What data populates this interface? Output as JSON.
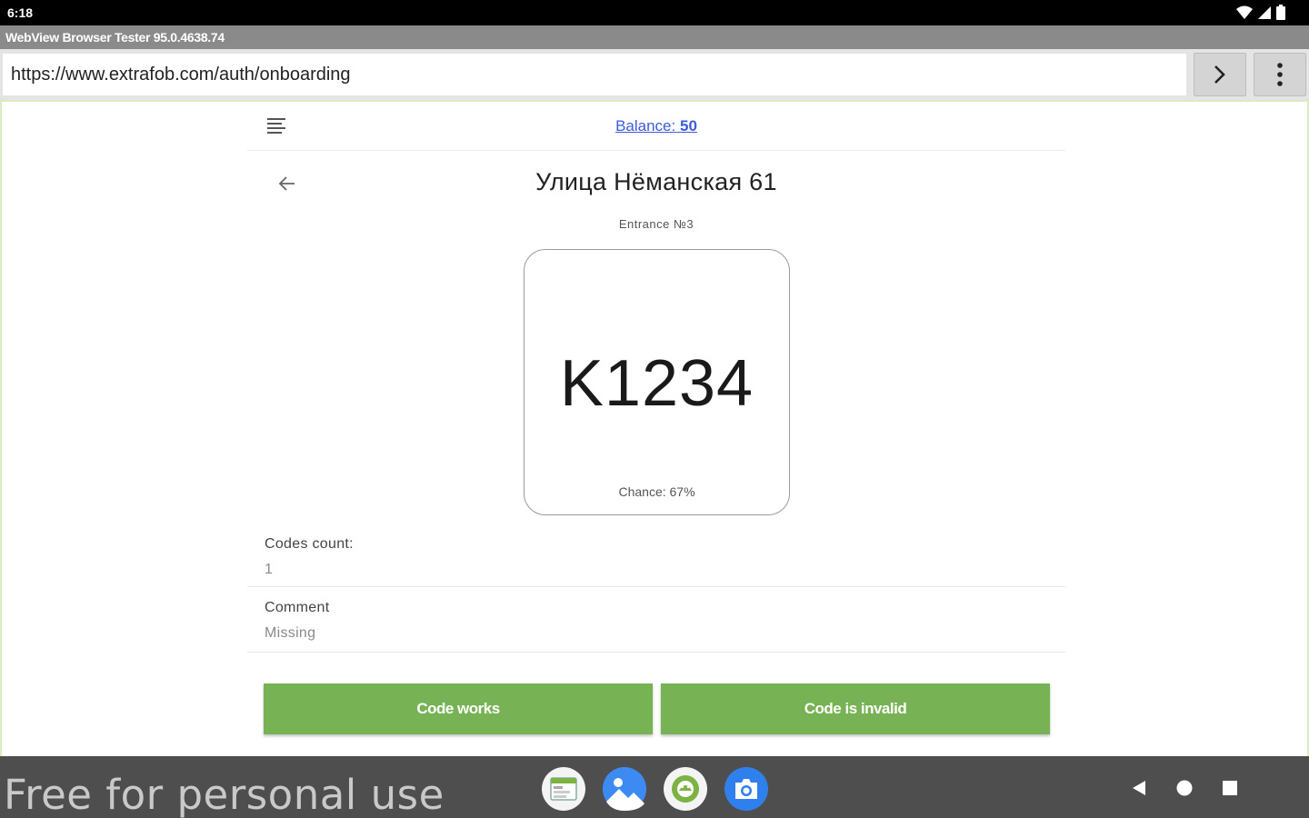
{
  "status_bar": {
    "time": "6:18"
  },
  "app": {
    "title": "WebView Browser Tester 95.0.4638.74"
  },
  "url_bar": {
    "url": "https://www.extrafob.com/auth/onboarding"
  },
  "header": {
    "balance_label": "Balance:",
    "balance_value": "50"
  },
  "address": {
    "title": "Улица Нёманская 61",
    "entrance": "Entrance №3"
  },
  "code": {
    "value": "K1234",
    "chance": "Chance: 67%"
  },
  "fields": {
    "codes_count": {
      "label": "Codes count:",
      "value": "1"
    },
    "comment": {
      "label": "Comment",
      "value": "Missing"
    }
  },
  "actions": {
    "works": "Code works",
    "invalid": "Code is invalid"
  },
  "bottom_bar": {
    "watermark": "Free for personal use"
  },
  "colors": {
    "accent_green": "#77b255",
    "link_blue": "#3b5bdb"
  }
}
